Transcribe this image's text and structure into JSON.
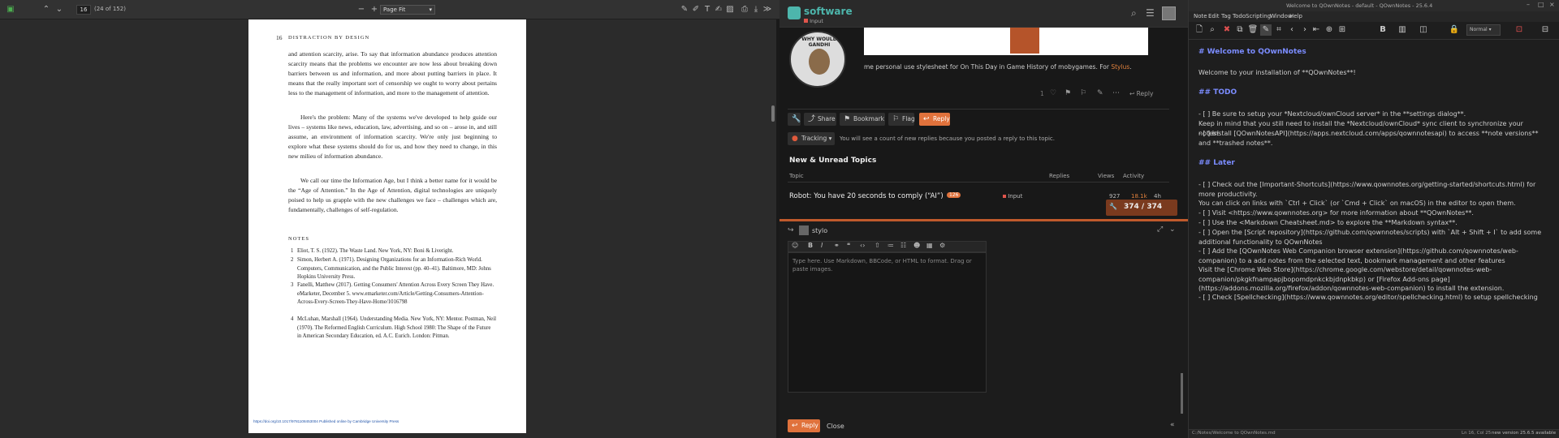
{
  "pdf": {
    "page_number": "16",
    "page_count": "(24 of 152)",
    "zoom": "Page Fit",
    "running_head_num": "16",
    "running_head": "DISTRACTION BY DESIGN",
    "paragraphs": [
      "and attention scarcity, arise. To say that information abundance produces attention scarcity means that the problems we encounter are now less about breaking down barriers between us and information, and more about putting barriers in place. It means that the really important sort of censorship we ought to worry about pertains less to the management of information, and more to the management of attention.",
      "Here's the problem: Many of the systems we've developed to help guide our lives – systems like news, education, law, advertising, and so on – arose in, and still assume, an environment of information scarcity. We're only just beginning to explore what these systems should do for us, and how they need to change, in this new milieu of information abundance.",
      "We call our time the Information Age, but I think a better name for it would be the “Age of Attention.” In the Age of Attention, digital technologies are uniquely poised to help us grapple with the new challenges we face – challenges which are, fundamentally, challenges of self-regulation."
    ],
    "notes_heading": "NOTES",
    "notes": [
      {
        "n": "1",
        "text": "Eliot, T. S. (1922). The Waste Land. New York, NY: Boni & Liveright."
      },
      {
        "n": "2",
        "text": "Simon, Herbert A. (1971). Designing Organizations for an Information-Rich World. Computers, Communication, and the Public Interest (pp. 40–41). Baltimore, MD: Johns Hopkins University Press."
      },
      {
        "n": "3",
        "text": "Fanelli, Matthew (2017). Getting Consumers' Attention Across Every Screen They Have. eMarketer, December 5. www.emarketer.com/Article/Getting-Consumers-Attention-Across-Every-Screen-They-Have-Home/1016798"
      },
      {
        "n": "4",
        "text": "McLuhan, Marshall (1964). Understanding Media. New York, NY: Mentor. Postman, Neil (1970). The Reformed English Curriculum. High School 1980: The Shape of the Future in American Secondary Education, ed. A.C. Eurich. London: Pitman."
      }
    ],
    "footer": "https://doi.org/10.1017/9781108453004 Published online by Cambridge University Press"
  },
  "discourse": {
    "site_name": "software",
    "category": "Input",
    "post_text": "me personal use stylesheet for On This Day in Game History of mobygames. For",
    "post_link": "Stylus",
    "like_count": "1",
    "reply_label": "Reply",
    "share_label": "Share",
    "bookmark_label": "Bookmark",
    "flag_label": "Flag",
    "reply_button_label": "Reply",
    "tracking_label": "Tracking",
    "tracking_text": "You will see a count of new replies because you posted a reply to this topic.",
    "section_title": "New & Unread Topics",
    "table_headers": {
      "topic": "Topic",
      "replies": "Replies",
      "views": "Views",
      "activity": "Activity"
    },
    "topic": {
      "title": "Robot: You have 20 seconds to comply (“AI”)",
      "badge": "126",
      "category": "Input",
      "views": "927",
      "activity": "18.1k",
      "age": "4h"
    },
    "progress": "374 / 374",
    "composer_user": "stylo",
    "composer_placeholder": "Type here. Use Markdown, BBCode, or HTML to format. Drag or paste images.",
    "composer_reply": "Reply",
    "composer_close": "Close",
    "avatar_text": "WHY WOULD GANDHI"
  },
  "qownnotes": {
    "title": "Welcome to QOwnNotes - default - QOwnNotes - 25.6.4",
    "menu": [
      "Note",
      "Edit",
      "Tag",
      "Todo",
      "Scripting",
      "Window",
      "Help"
    ],
    "heading_font": "Normal",
    "lines": [
      {
        "cls": "h1",
        "text": "# Welcome to QOwnNotes"
      },
      {
        "cls": "",
        "text": "Welcome to your installation of **QOwnNotes**!"
      },
      {
        "cls": "h1",
        "text": "## TODO"
      },
      {
        "cls": "",
        "text": "- [ ] Be sure to setup your *Nextcloud/ownCloud server* in the **settings dialog**."
      },
      {
        "cls": "",
        "text": "  Keep in mind that you still need to install the *Nextcloud/ownCloud* sync client to synchronize your notes!"
      },
      {
        "cls": "",
        "text": "- [ ] Install [QOwnNotesAPI](https://apps.nextcloud.com/apps/qownnotesapi) to access **note versions** and **trashed notes**."
      },
      {
        "cls": "h1",
        "text": "## Later"
      },
      {
        "cls": "",
        "text": "- [ ] Check out the [Important-Shortcuts](https://www.qownnotes.org/getting-started/shortcuts.html) for more productivity."
      },
      {
        "cls": "",
        "text": "  You can click on links with `Ctrl + Click` (or `Cmd + Click` on macOS) in the editor to open them."
      },
      {
        "cls": "",
        "text": "- [ ] Visit <https://www.qownnotes.org> for more information about **QOwnNotes**."
      },
      {
        "cls": "",
        "text": "- [ ] Use the <Markdown Cheatsheet.md> to explore the **Markdown syntax**."
      },
      {
        "cls": "",
        "text": "- [ ] Open the [Script repository](https://github.com/qownnotes/scripts) with `Alt + Shift + I` to add some additional functionality to QOwnNotes"
      },
      {
        "cls": "",
        "text": "- [ ] Add the [QOwnNotes Web Companion browser extension](https://github.com/qownnotes/web-companion) to a add notes from the selected text, bookmark management and other features"
      },
      {
        "cls": "",
        "text": "  Visit the [Chrome Web Store](https://chrome.google.com/webstore/detail/qownnotes-web-companion/pkgkfnampapjbopomdpnkckbjdnpkbkp) or [Firefox Add-ons page](https://addons.mozilla.org/firefox/addon/qownnotes-web-companion) to install the extension."
      },
      {
        "cls": "",
        "text": "- [ ] Check [Spellchecking](https://www.qownnotes.org/editor/spellchecking.html) to setup spellchecking"
      }
    ],
    "status_left": "C:/Notes/Welcome to QOwnNotes.md",
    "status_pos": "Ln 16, Col 25",
    "status_version": "new version 25.6.5 available"
  }
}
